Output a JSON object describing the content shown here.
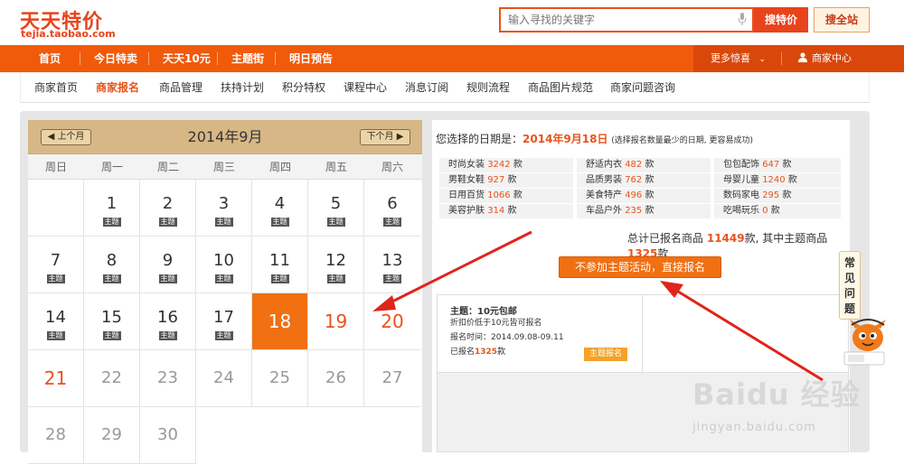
{
  "logo": {
    "main": "天天特价",
    "sub": "tejia.taobao.com"
  },
  "search": {
    "placeholder": "输入寻找的关键字",
    "btn_deal": "搜特价",
    "btn_all": "搜全站"
  },
  "nav": {
    "items": [
      "首页",
      "今日特卖",
      "天天10元",
      "主题街",
      "明日预告"
    ],
    "more": "更多惊喜",
    "merchant": "商家中心"
  },
  "subnav": {
    "items": [
      "商家首页",
      "商家报名",
      "商品管理",
      "扶持计划",
      "积分特权",
      "课程中心",
      "消息订阅",
      "规则流程",
      "商品图片规范",
      "商家问题咨询"
    ],
    "active_index": 1
  },
  "calendar": {
    "title": "2014年9月",
    "prev": "上个月",
    "next": "下个月",
    "weekdays": [
      "周日",
      "周一",
      "周二",
      "周三",
      "周四",
      "周五",
      "周六"
    ],
    "tag_label": "主题",
    "selected_day": 18,
    "days": [
      {
        "n": "",
        "tag": false,
        "state": "blank"
      },
      {
        "n": "1",
        "tag": true,
        "state": "normal"
      },
      {
        "n": "2",
        "tag": true,
        "state": "normal"
      },
      {
        "n": "3",
        "tag": true,
        "state": "normal"
      },
      {
        "n": "4",
        "tag": true,
        "state": "normal"
      },
      {
        "n": "5",
        "tag": true,
        "state": "normal"
      },
      {
        "n": "6",
        "tag": true,
        "state": "normal"
      },
      {
        "n": "7",
        "tag": true,
        "state": "normal"
      },
      {
        "n": "8",
        "tag": true,
        "state": "normal"
      },
      {
        "n": "9",
        "tag": true,
        "state": "normal"
      },
      {
        "n": "10",
        "tag": true,
        "state": "normal"
      },
      {
        "n": "11",
        "tag": true,
        "state": "normal"
      },
      {
        "n": "12",
        "tag": true,
        "state": "normal"
      },
      {
        "n": "13",
        "tag": true,
        "state": "normal"
      },
      {
        "n": "14",
        "tag": true,
        "state": "normal"
      },
      {
        "n": "15",
        "tag": true,
        "state": "normal"
      },
      {
        "n": "16",
        "tag": true,
        "state": "normal"
      },
      {
        "n": "17",
        "tag": true,
        "state": "normal"
      },
      {
        "n": "18",
        "tag": false,
        "state": "selected"
      },
      {
        "n": "19",
        "tag": false,
        "state": "highlight"
      },
      {
        "n": "20",
        "tag": false,
        "state": "highlight"
      },
      {
        "n": "21",
        "tag": false,
        "state": "highlight"
      },
      {
        "n": "22",
        "tag": false,
        "state": "muted"
      },
      {
        "n": "23",
        "tag": false,
        "state": "muted"
      },
      {
        "n": "24",
        "tag": false,
        "state": "muted"
      },
      {
        "n": "25",
        "tag": false,
        "state": "muted"
      },
      {
        "n": "26",
        "tag": false,
        "state": "muted"
      },
      {
        "n": "27",
        "tag": false,
        "state": "muted"
      },
      {
        "n": "28",
        "tag": false,
        "state": "muted"
      },
      {
        "n": "29",
        "tag": false,
        "state": "muted"
      },
      {
        "n": "30",
        "tag": false,
        "state": "muted"
      }
    ]
  },
  "selection": {
    "label": "您选择的日期是：",
    "date": "2014年9月18日",
    "note": "(选择报名数量最少的日期, 更容易成功)"
  },
  "categories": [
    {
      "name": "时尚女装",
      "count": "3242",
      "unit": "款"
    },
    {
      "name": "舒适内衣",
      "count": "482",
      "unit": "款"
    },
    {
      "name": "包包配饰",
      "count": "647",
      "unit": "款"
    },
    {
      "name": "男鞋女鞋",
      "count": "927",
      "unit": "款"
    },
    {
      "name": "品质男装",
      "count": "762",
      "unit": "款"
    },
    {
      "name": "母婴儿童",
      "count": "1240",
      "unit": "款"
    },
    {
      "name": "日用百货",
      "count": "1066",
      "unit": "款"
    },
    {
      "name": "美食特产",
      "count": "496",
      "unit": "款"
    },
    {
      "name": "数码家电",
      "count": "295",
      "unit": "款"
    },
    {
      "name": "美容护肤",
      "count": "314",
      "unit": "款"
    },
    {
      "name": "车品户外",
      "count": "235",
      "unit": "款"
    },
    {
      "name": "吃喝玩乐",
      "count": "0",
      "unit": "款"
    }
  ],
  "total": {
    "prefix": "总计已报名商品",
    "all": "11449",
    "mid": "款, 其中主题商品",
    "theme": "1325",
    "suffix": "款"
  },
  "direct_button": "不参加主题活动，直接报名",
  "theme": {
    "title": "主题：10元包邮",
    "line1": "折扣价低于10元皆可报名",
    "line2": "报名时间：2014.09.08-09.11",
    "line3_prefix": "已报名",
    "line3_count": "1325",
    "line3_suffix": "款",
    "button": "主题报名"
  },
  "faq": [
    "常",
    "见",
    "问",
    "题"
  ],
  "watermark": {
    "main": "Baidu 经验",
    "sub": "jingyan.baidu.com"
  },
  "colors": {
    "brand": "#e8431b",
    "nav": "#f05a0a",
    "selected": "#f07012",
    "highlight": "#e8531b"
  }
}
